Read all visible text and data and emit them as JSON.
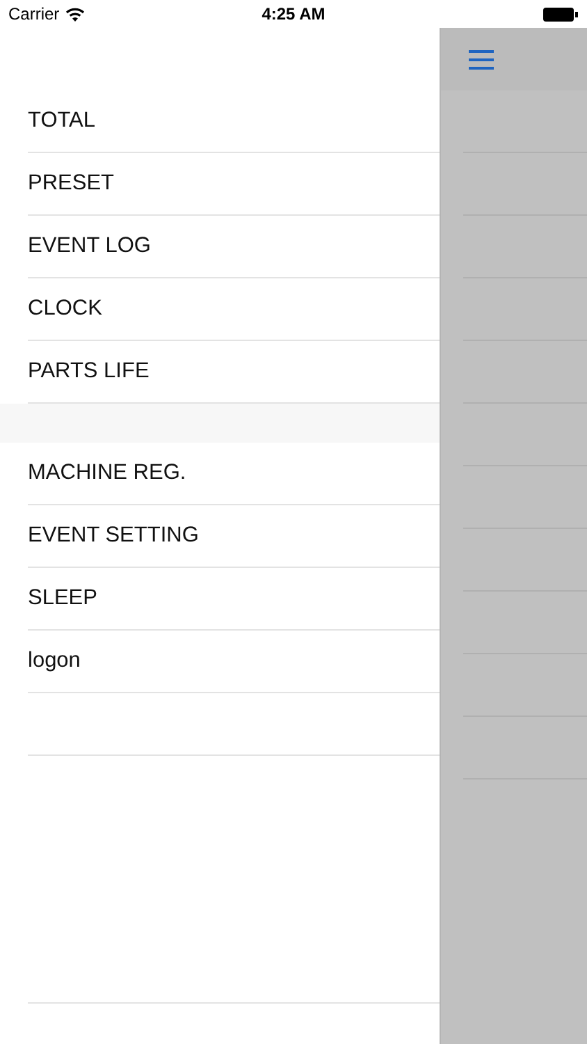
{
  "status_bar": {
    "carrier": "Carrier",
    "time": "4:25 AM"
  },
  "menu_sections": [
    {
      "items": [
        {
          "label": "TOTAL"
        },
        {
          "label": "PRESET"
        },
        {
          "label": "EVENT LOG"
        },
        {
          "label": "CLOCK"
        },
        {
          "label": "PARTS LIFE"
        }
      ]
    },
    {
      "items": [
        {
          "label": "MACHINE REG."
        },
        {
          "label": "EVENT SETTING"
        },
        {
          "label": "SLEEP"
        },
        {
          "label": "logon"
        }
      ]
    }
  ]
}
